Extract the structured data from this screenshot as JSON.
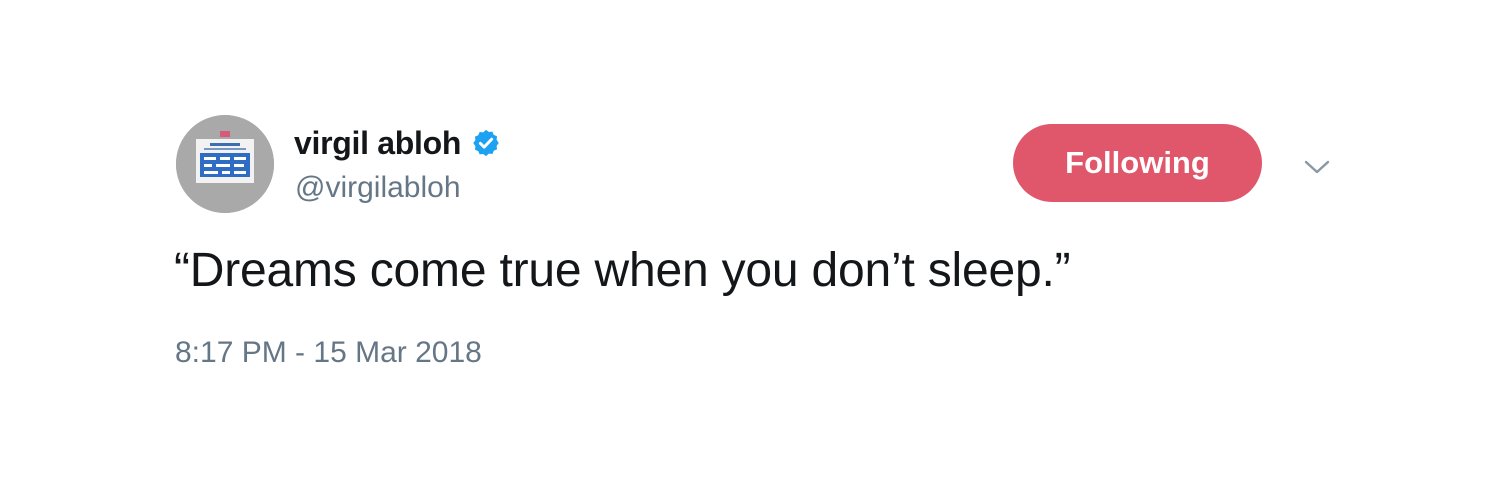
{
  "user": {
    "display_name": "virgil abloh",
    "handle": "@virgilabloh",
    "verified": true,
    "verified_icon": "verified-badge-icon",
    "avatar_icon": "avatar-image"
  },
  "actions": {
    "follow_label": "Following",
    "menu_icon": "chevron-down-icon"
  },
  "tweet": {
    "text": "“Dreams come true when you don’t sleep.”",
    "timestamp": "8:17 PM - 15 Mar 2018"
  },
  "colors": {
    "following_button": "#e0566b",
    "verified_blue": "#1da1f2",
    "primary_text": "#14171a",
    "secondary_text": "#657786",
    "background": "#ffffff"
  }
}
